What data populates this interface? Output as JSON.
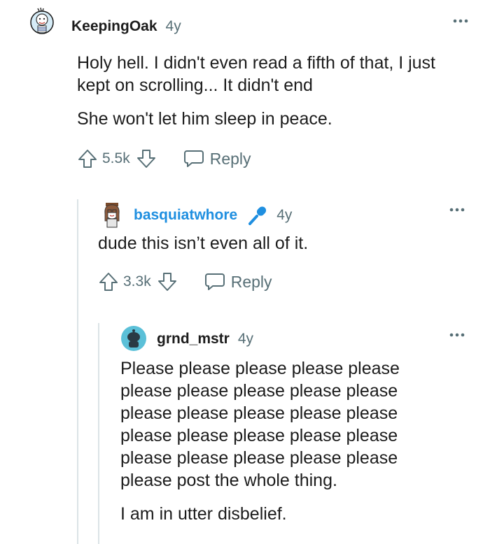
{
  "comments": [
    {
      "username": "KeepingOak",
      "age": "4y",
      "paragraphs": [
        "Holy hell. I didn't even read a fifth of that, I just kept on scrolling... It didn't end",
        "She won't let him sleep in peace."
      ],
      "score": "5.5k",
      "reply_label": "Reply",
      "avatar_icon": "cartoon-avatar-icon"
    },
    {
      "username": "basquiatwhore",
      "age": "4y",
      "badge_icon": "microphone-icon",
      "paragraphs": [
        "dude this isn’t even all of it."
      ],
      "score": "3.3k",
      "reply_label": "Reply",
      "avatar_icon": "cartoon-avatar-icon"
    },
    {
      "username": "grnd_mstr",
      "age": "4y",
      "paragraphs": [
        "Please please please please please please please please please please please please please please please please please please please please please please please please please please post the whole thing.",
        "I am in utter disbelief."
      ],
      "avatar_icon": "snoo-avatar-icon"
    }
  ],
  "colors": {
    "username_op": "#1f8fe0",
    "meta": "#576f76",
    "thread_line": "#dbe3e6",
    "snoo_bg": "#5bc0d8"
  }
}
